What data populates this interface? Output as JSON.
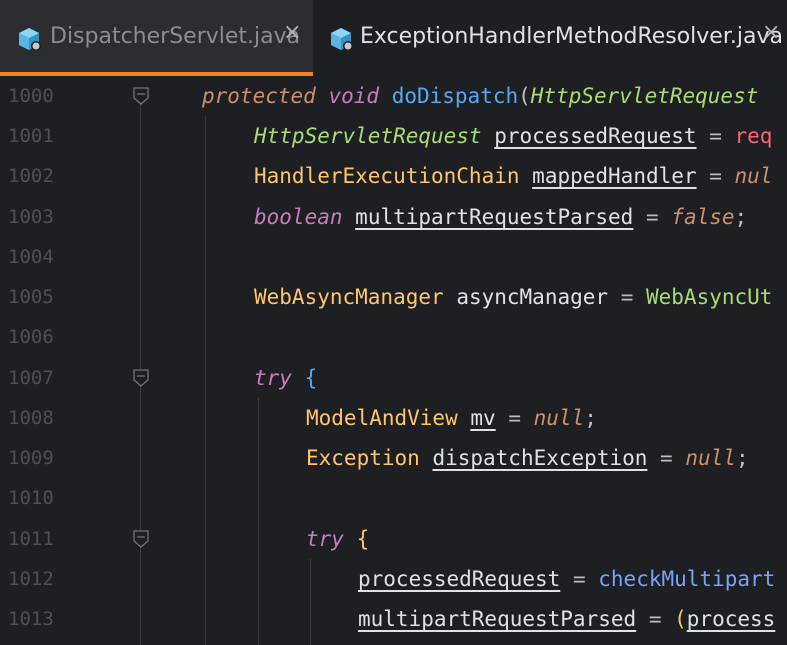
{
  "tabs": [
    {
      "label": "DispatcherServlet.java",
      "active": true
    },
    {
      "label": "ExceptionHandlerMethodResolver.java",
      "active": false
    }
  ],
  "close_glyph": "×",
  "line_numbers": [
    "1000",
    "1001",
    "1002",
    "1003",
    "1004",
    "1005",
    "1006",
    "1007",
    "1008",
    "1009",
    "1010",
    "1011",
    "1012",
    "1013"
  ],
  "code": {
    "l1000": [
      "protected",
      "void",
      "doDispatch",
      "(",
      "HttpServletRequest"
    ],
    "l1001": [
      "HttpServletRequest",
      "processedRequest",
      "=",
      "req"
    ],
    "l1002": [
      "HandlerExecutionChain",
      "mappedHandler",
      "=",
      "nul"
    ],
    "l1003": [
      "boolean",
      "multipartRequestParsed",
      "=",
      "false",
      ";"
    ],
    "l1005": [
      "WebAsyncManager",
      "asyncManager",
      "=",
      "WebAsyncUt"
    ],
    "l1007": [
      "try",
      "{"
    ],
    "l1008": [
      "ModelAndView",
      "mv",
      "=",
      "null",
      ";"
    ],
    "l1009": [
      "Exception",
      "dispatchException",
      "=",
      "null",
      ";"
    ],
    "l1011": [
      "try",
      "{"
    ],
    "l1012": [
      "processedRequest",
      "=",
      "checkMultipart"
    ],
    "l1013": [
      "multipartRequestParsed",
      "=",
      "(",
      "process"
    ]
  },
  "colors": {
    "accent_tab_underline": "#f58220",
    "background": "#1e1f22"
  },
  "icons": {
    "file": "java-class-icon",
    "close": "close-icon",
    "fold": "fold-marker-icon"
  }
}
